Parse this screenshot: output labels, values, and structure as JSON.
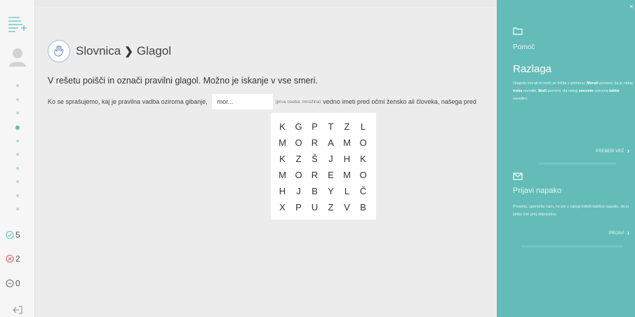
{
  "sidebar": {
    "stats": {
      "correct": "5",
      "wrong": "2",
      "skipped": "0"
    }
  },
  "breadcrumb": {
    "section": "Slovnica",
    "page": "Glagol"
  },
  "instruction": "V rešetu poišči in označi pravilni glagol. Možno je iskanje v vse smeri.",
  "sentence": {
    "before": "Ko se sprašujemo, kaj je pravilna vadba oziroma gibanje,",
    "input_value": "mor...",
    "hint": "(prva oseba, množina)",
    "after": "vedno imeti pred očmi žensko ali človeka, našega pred"
  },
  "grid": [
    [
      "K",
      "G",
      "P",
      "T",
      "Z",
      "L"
    ],
    [
      "M",
      "O",
      "R",
      "A",
      "M",
      "O"
    ],
    [
      "K",
      "Z",
      "Š",
      "J",
      "H",
      "K"
    ],
    [
      "M",
      "O",
      "R",
      "E",
      "M",
      "O"
    ],
    [
      "H",
      "J",
      "B",
      "Y",
      "L",
      "Č"
    ],
    [
      "X",
      "P",
      "U",
      "Z",
      "V",
      "B"
    ]
  ],
  "help": {
    "close": "×",
    "pomoc": "Pomoč",
    "razlaga_title": "Razlaga",
    "razlaga_parts": [
      {
        "t": "Glagola morati in moči se ločita v pomenu. ",
        "b": false
      },
      {
        "t": "Morati",
        "b": true
      },
      {
        "t": " pomeni, da je nekaj ",
        "b": false
      },
      {
        "t": "treba",
        "b": true
      },
      {
        "t": " narediti. ",
        "b": false
      },
      {
        "t": "Moči",
        "b": true
      },
      {
        "t": " pomeni, da nekaj ",
        "b": false
      },
      {
        "t": "zmorem",
        "b": true
      },
      {
        "t": " oziroma ",
        "b": false
      },
      {
        "t": "lahko",
        "b": true
      },
      {
        "t": " naredim.",
        "b": false
      }
    ],
    "read_more": "PREBERI VEČ",
    "report_title": "Prijavi napako",
    "report_text": "Prosimo, sporočite nam, če ste v nalogi odkrili kakšno napako, da jo lahko čim prej odpravimo.",
    "report_button": "PRIJAVI"
  },
  "colors": {
    "teal": "#63bcb8",
    "correct": "#5fbcb8",
    "wrong": "#e05a5a"
  }
}
